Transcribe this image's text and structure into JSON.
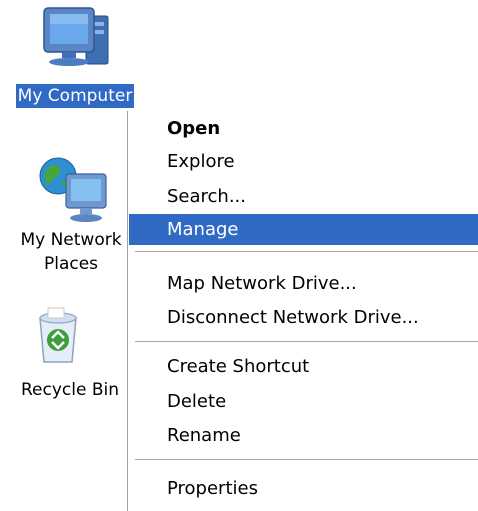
{
  "desktop": {
    "icons": [
      {
        "label": "My Computer",
        "icon": "my-computer-icon"
      },
      {
        "label_line1": "My Network",
        "label_line2": "Places",
        "icon": "network-places-icon"
      },
      {
        "label": "Recycle Bin",
        "icon": "recycle-bin-icon"
      }
    ]
  },
  "context_menu": {
    "items": [
      {
        "label": "Open"
      },
      {
        "label": "Explore"
      },
      {
        "label": "Search..."
      },
      {
        "label": "Manage"
      },
      {
        "label": "Map Network Drive..."
      },
      {
        "label": "Disconnect Network Drive..."
      },
      {
        "label": "Create Shortcut"
      },
      {
        "label": "Delete"
      },
      {
        "label": "Rename"
      },
      {
        "label": "Properties"
      }
    ]
  },
  "colors": {
    "selection": "#316ac5",
    "separator": "#a7a6aa"
  }
}
